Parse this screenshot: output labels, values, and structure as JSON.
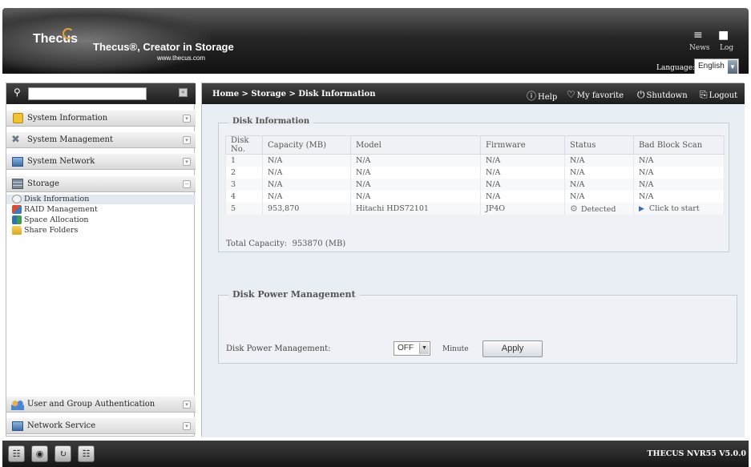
{
  "header": {
    "brand": "Thecus",
    "slogan": "Thecus®, Creator in Storage",
    "url": "www.thecus.com",
    "news_label": "News",
    "log_label": "Log",
    "language_label": "Language:",
    "language_value": "English"
  },
  "sidebar": {
    "categories": [
      {
        "label": "System Information"
      },
      {
        "label": "System Management"
      },
      {
        "label": "System Network"
      },
      {
        "label": "Storage"
      },
      {
        "label": "User and Group Authentication"
      },
      {
        "label": "Network Service"
      }
    ],
    "storage_items": [
      {
        "label": "Disk Information"
      },
      {
        "label": "RAID Management"
      },
      {
        "label": "Space Allocation"
      },
      {
        "label": "Share Folders"
      }
    ]
  },
  "topbar": {
    "breadcrumb": "Home > Storage > Disk Information",
    "help": "Help",
    "favorite": "My favorite",
    "shutdown": "Shutdown",
    "logout": "Logout"
  },
  "disk_info": {
    "legend": "Disk Information",
    "columns": [
      "Disk No.",
      "Capacity (MB)",
      "Model",
      "Firmware",
      "Status",
      "Bad Block Scan"
    ],
    "rows": [
      [
        "1",
        "N/A",
        "N/A",
        "N/A",
        "N/A",
        "N/A"
      ],
      [
        "2",
        "N/A",
        "N/A",
        "N/A",
        "N/A",
        "N/A"
      ],
      [
        "3",
        "N/A",
        "N/A",
        "N/A",
        "N/A",
        "N/A"
      ],
      [
        "4",
        "N/A",
        "N/A",
        "N/A",
        "N/A",
        "N/A"
      ],
      [
        "5",
        "953,870",
        "Hitachi HDS72101",
        "JP4O",
        "Detected",
        "Click to start"
      ]
    ],
    "total_label": "Total Capacity:",
    "total_value": "953870 (MB)"
  },
  "power": {
    "legend": "Disk Power Management",
    "label": "Disk Power Management:",
    "select_value": "OFF",
    "minute_label": "Minute",
    "apply_label": "Apply"
  },
  "footer": {
    "version": "THECUS NVR55 V5.0.0"
  }
}
